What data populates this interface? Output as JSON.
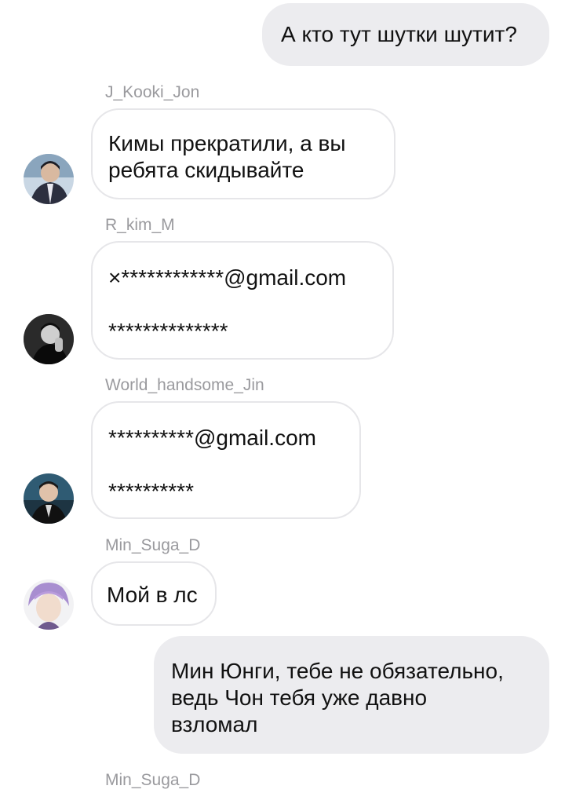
{
  "messages": [
    {
      "id": "m1",
      "direction": "outgoing",
      "text": "А кто тут шутки шутит?"
    },
    {
      "id": "m2",
      "direction": "incoming",
      "sender": "J_Kooki_Jon",
      "avatar": "avatar-photo-icon",
      "text": "Кимы прекратили, а вы\nребята скидывайте"
    },
    {
      "id": "m3",
      "direction": "incoming",
      "sender": "R_kim_M",
      "avatar": "avatar-photo-icon",
      "text": "×************@gmail.com\n\n**************"
    },
    {
      "id": "m4",
      "direction": "incoming",
      "sender": "World_handsome_Jin",
      "avatar": "avatar-photo-icon",
      "text": "**********@gmail.com\n\n**********"
    },
    {
      "id": "m5",
      "direction": "incoming",
      "sender": "Min_Suga_D",
      "avatar": "avatar-photo-icon",
      "text": "Мой в лс"
    },
    {
      "id": "m6",
      "direction": "outgoing",
      "text": "Мин Юнги, тебе не обязательно,\nведь Чон тебя уже давно\nвзломал"
    },
    {
      "id": "m7",
      "direction": "incoming",
      "sender": "Min_Suga_D"
    }
  ],
  "colors": {
    "outgoing_bubble": "#ececef",
    "incoming_border": "#e6e6e9",
    "sender_name": "#9a9a9e"
  }
}
